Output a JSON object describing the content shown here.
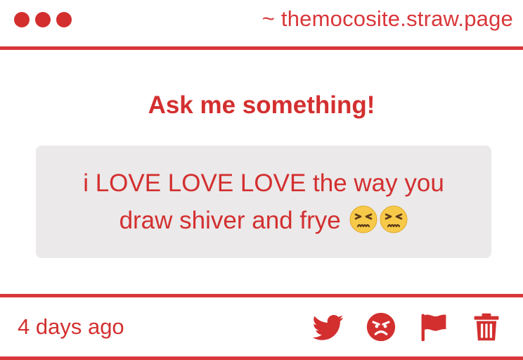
{
  "header": {
    "window_dots": [
      "dot",
      "dot",
      "dot"
    ],
    "site": "~ themocosite.straw.page"
  },
  "main": {
    "title": "Ask me something!",
    "question_text": "i LOVE LOVE LOVE the way you draw shiver and frye",
    "question_emojis": [
      "persevering-face-emoji",
      "persevering-face-emoji"
    ]
  },
  "footer": {
    "timestamp": "4 days ago",
    "actions": [
      "twitter-icon",
      "angry-face-icon",
      "flag-icon",
      "trash-icon"
    ]
  },
  "colors": {
    "accent": "#d32f2f",
    "border": "#d9363a",
    "question_bg": "#ebe9ea",
    "background": "#ffffff"
  }
}
